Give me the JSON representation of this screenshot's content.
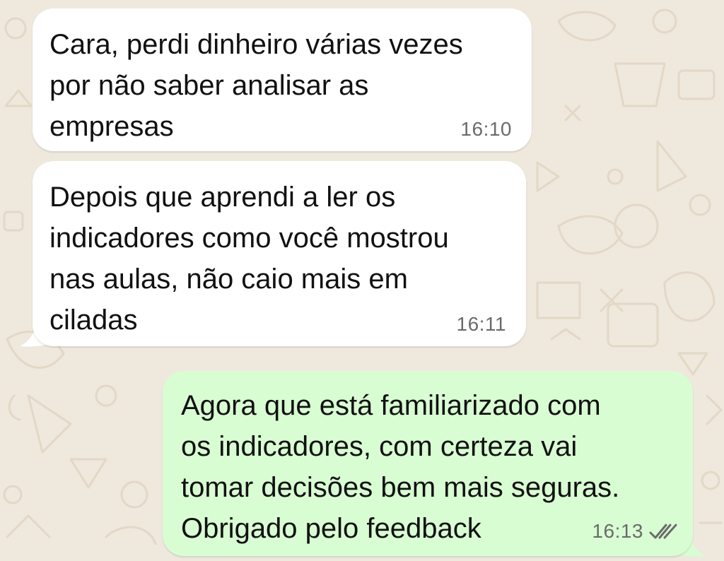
{
  "colors": {
    "wallpaper": "#efe8dd",
    "doodle": "#e3d8c5",
    "incoming_bubble": "#ffffff",
    "outgoing_bubble": "#d9fdd3",
    "timestamp": "#6b6b6b"
  },
  "messages": [
    {
      "direction": "incoming",
      "text": "Cara, perdi dinheiro várias vezes\npor não saber analisar as\nempresas",
      "time": "16:10"
    },
    {
      "direction": "incoming",
      "text": "Depois que aprendi a ler os\nindicadores como você mostrou\nnas aulas, não caio mais em\nciladas",
      "time": "16:11"
    },
    {
      "direction": "outgoing",
      "text": "Agora que está familiarizado com\nos indicadores, com certeza vai\ntomar decisões bem mais seguras.\nObrigado pelo feedback",
      "time": "16:13",
      "status_icon": "double-check-icon",
      "status_color": "#6b6b6b"
    }
  ]
}
